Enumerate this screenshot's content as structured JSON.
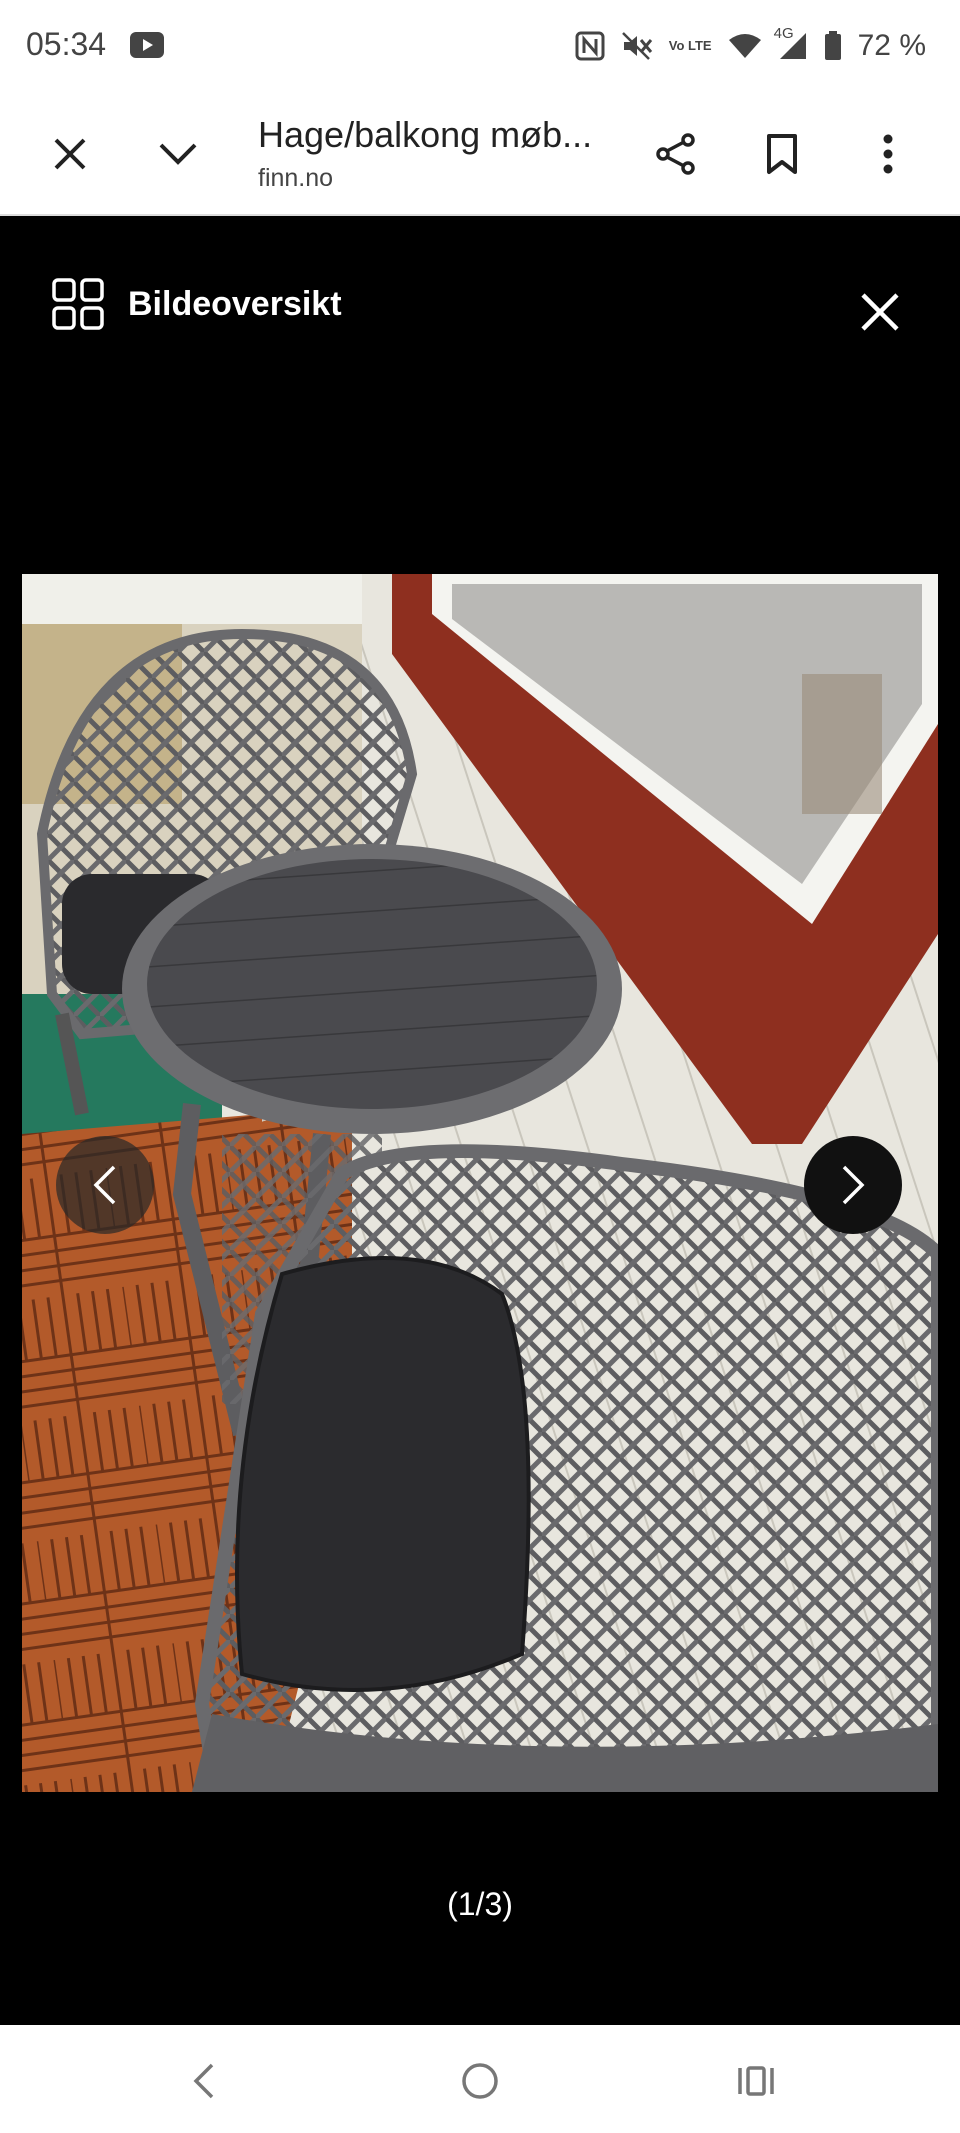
{
  "status_bar": {
    "time": "05:34",
    "battery": "72 %",
    "network": "4G",
    "volte": "Vo LTE",
    "icons": [
      "youtube-icon",
      "nfc-icon",
      "mute-icon",
      "volte-icon",
      "wifi-icon",
      "signal-icon",
      "battery-icon"
    ]
  },
  "toolbar": {
    "title": "Hage/balkong møb...",
    "domain": "finn.no",
    "icons": [
      "close-icon",
      "chevron-down-icon",
      "share-icon",
      "bookmark-icon",
      "more-vert-icon"
    ]
  },
  "viewer": {
    "overview_label": "Bildeoversikt",
    "counter": "(1/3)",
    "image_alt": "Grey rattan bistro table and chairs with black cushions on a balcony"
  },
  "navigation": {
    "icons": [
      "back-icon",
      "home-icon",
      "recents-icon"
    ]
  }
}
